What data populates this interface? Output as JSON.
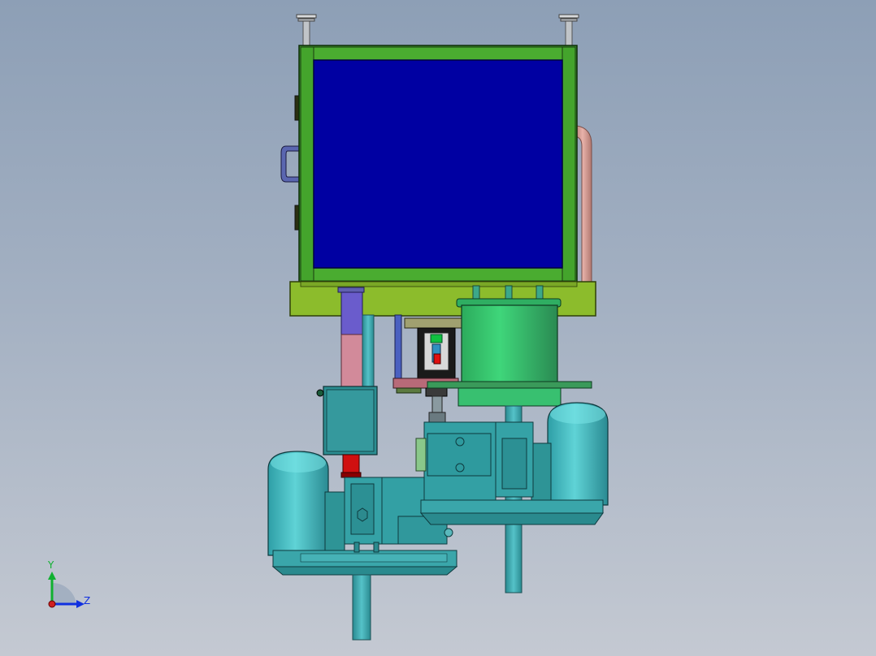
{
  "viewport": {
    "background_top": "#8d9fb6",
    "background_bottom": "#c4c9d2"
  },
  "model": {
    "frame_color": "#3c9a2a",
    "panel_color": "#0000a2",
    "base_plate_color": "#8cbc2c",
    "motor_color": "#3fb3b8",
    "tank_color": "#2ec06a",
    "pipe_color": "#d69a92",
    "valve_red": "#d01010"
  },
  "triad": {
    "y_label": "Y",
    "z_label": "Z",
    "y_color": "#10b030",
    "z_color": "#1030e0",
    "origin_color": "#d02020"
  }
}
